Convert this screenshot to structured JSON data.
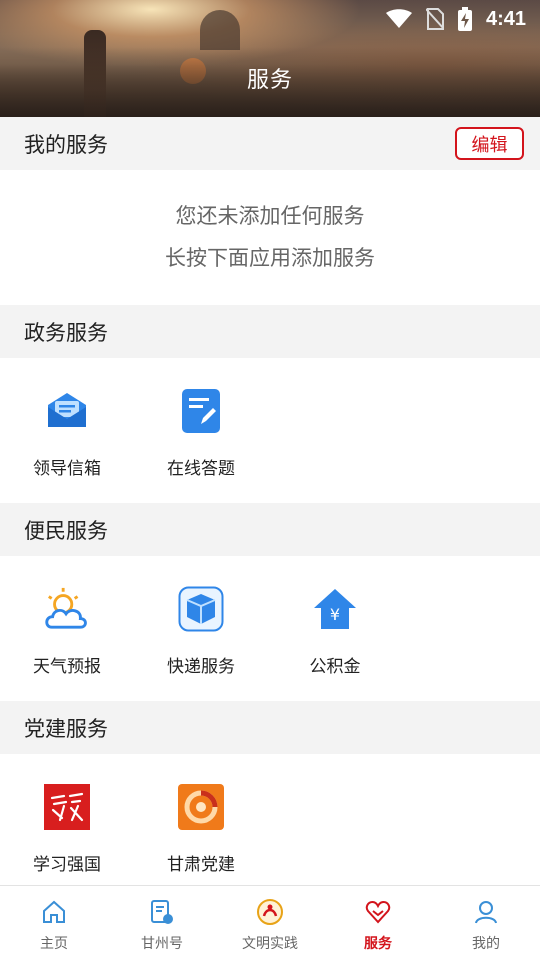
{
  "status_bar": {
    "time": "4:41"
  },
  "header": {
    "title": "服务"
  },
  "my_services": {
    "title": "我的服务",
    "edit_label": "编辑",
    "empty_line1": "您还未添加任何服务",
    "empty_line2": "长按下面应用添加服务"
  },
  "sections": [
    {
      "title": "政务服务",
      "items": [
        {
          "label": "领导信箱",
          "icon": "mailbox-icon"
        },
        {
          "label": "在线答题",
          "icon": "quiz-icon"
        }
      ]
    },
    {
      "title": "便民服务",
      "items": [
        {
          "label": "天气预报",
          "icon": "weather-icon"
        },
        {
          "label": "快递服务",
          "icon": "package-icon"
        },
        {
          "label": "公积金",
          "icon": "housing-fund-icon"
        }
      ]
    },
    {
      "title": "党建服务",
      "items": [
        {
          "label": "学习强国",
          "icon": "xuexi-logo-icon"
        },
        {
          "label": "甘肃党建",
          "icon": "gansu-party-logo-icon"
        }
      ]
    }
  ],
  "bottom_nav": [
    {
      "label": "主页",
      "icon": "home-icon"
    },
    {
      "label": "甘州号",
      "icon": "document-icon"
    },
    {
      "label": "文明实践",
      "icon": "civilization-emblem-icon"
    },
    {
      "label": "服务",
      "icon": "heart-hands-icon",
      "active": true
    },
    {
      "label": "我的",
      "icon": "user-icon"
    }
  ],
  "colors": {
    "accent": "#d3141c",
    "icon_blue": "#2f86e8",
    "nav_blue": "#3a8fd6"
  }
}
